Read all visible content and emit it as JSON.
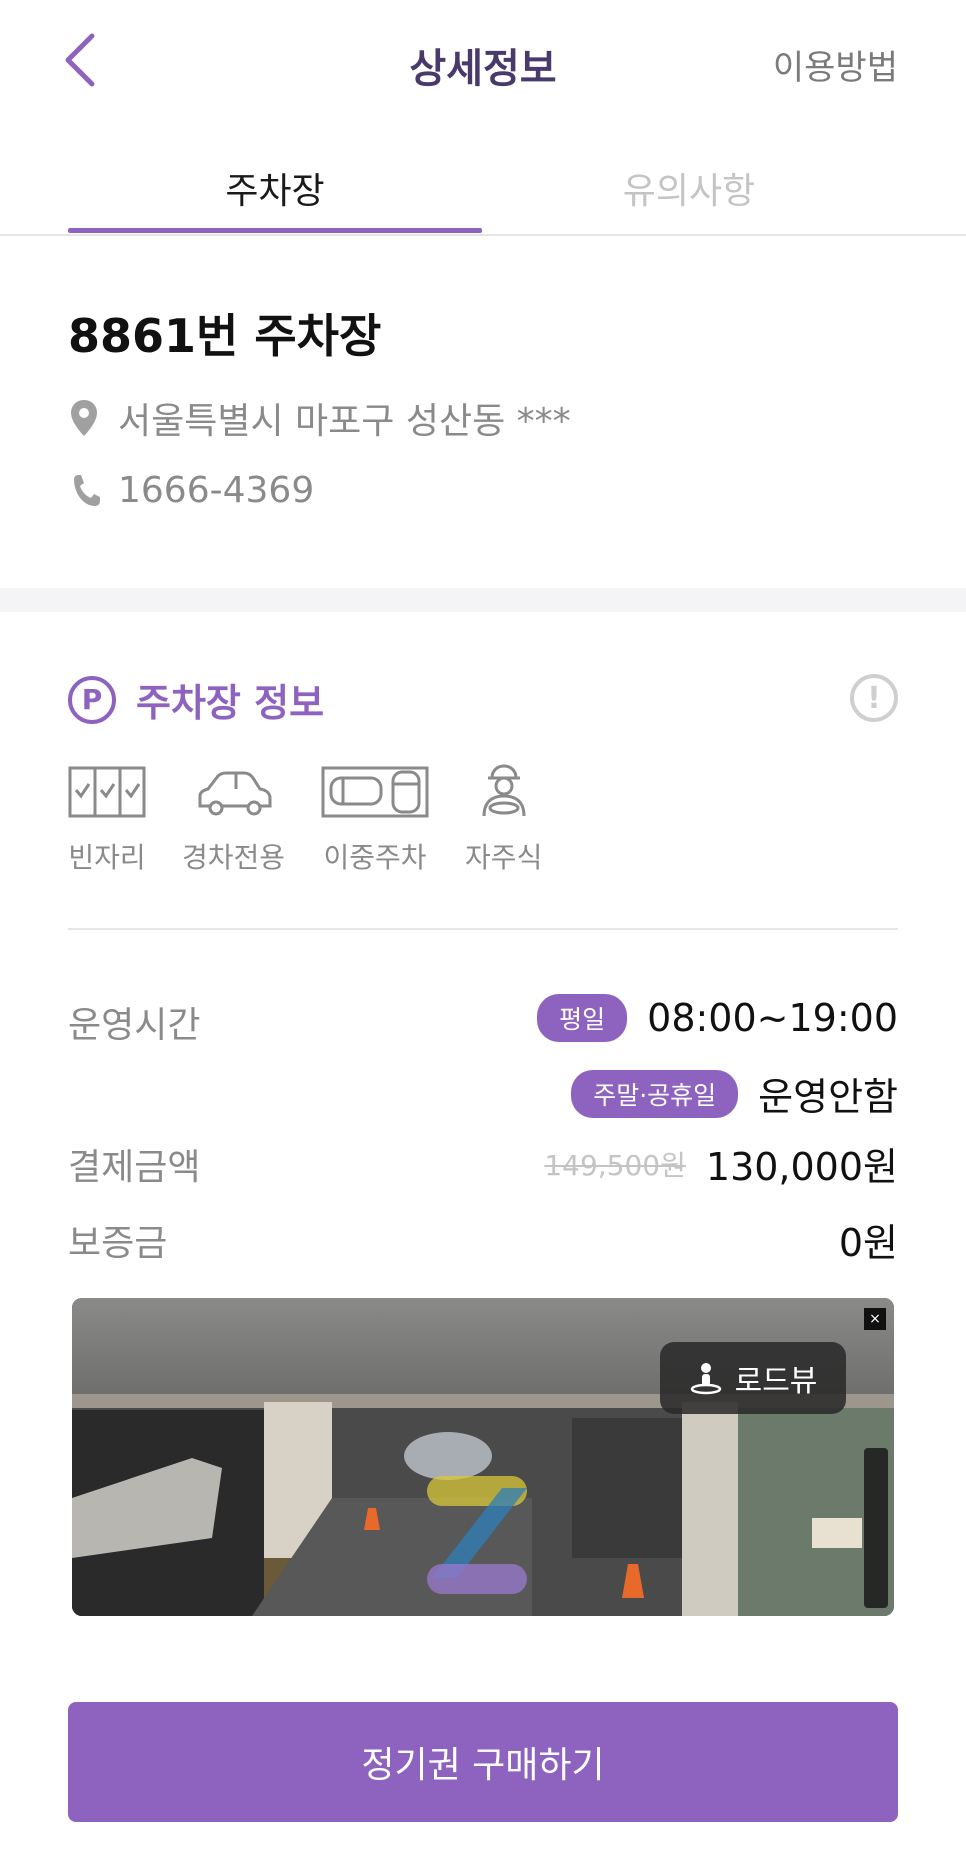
{
  "header": {
    "title": "상세정보",
    "help_link": "이용방법"
  },
  "tabs": [
    {
      "label": "주차장",
      "active": true
    },
    {
      "label": "유의사항",
      "active": false
    }
  ],
  "lot": {
    "name": "8861번 주차장",
    "address": "서울특별시 마포구 성산동 ***",
    "phone": "1666-4369"
  },
  "section": {
    "title": "주차장 정보",
    "p_icon": "P",
    "info_icon": "!"
  },
  "features": [
    {
      "label": "빈자리",
      "icon": "checkbox-slots-icon"
    },
    {
      "label": "경차전용",
      "icon": "compact-car-icon"
    },
    {
      "label": "이중주차",
      "icon": "double-parking-icon"
    },
    {
      "label": "자주식",
      "icon": "driver-icon"
    }
  ],
  "operation": {
    "label": "운영시간",
    "weekday_badge": "평일",
    "weekday_hours": "08:00~19:00",
    "weekend_badge": "주말·공휴일",
    "weekend_hours": "운영안함"
  },
  "payment": {
    "label": "결제금액",
    "original_price": "149,500원",
    "price": "130,000원"
  },
  "deposit": {
    "label": "보증금",
    "value": "0원"
  },
  "roadview": {
    "label": "로드뷰",
    "close": "×"
  },
  "cta": {
    "label": "정기권 구매하기"
  },
  "colors": {
    "accent": "#8e63bf",
    "header_title": "#4a3a6b",
    "muted": "#8a8a8a"
  }
}
